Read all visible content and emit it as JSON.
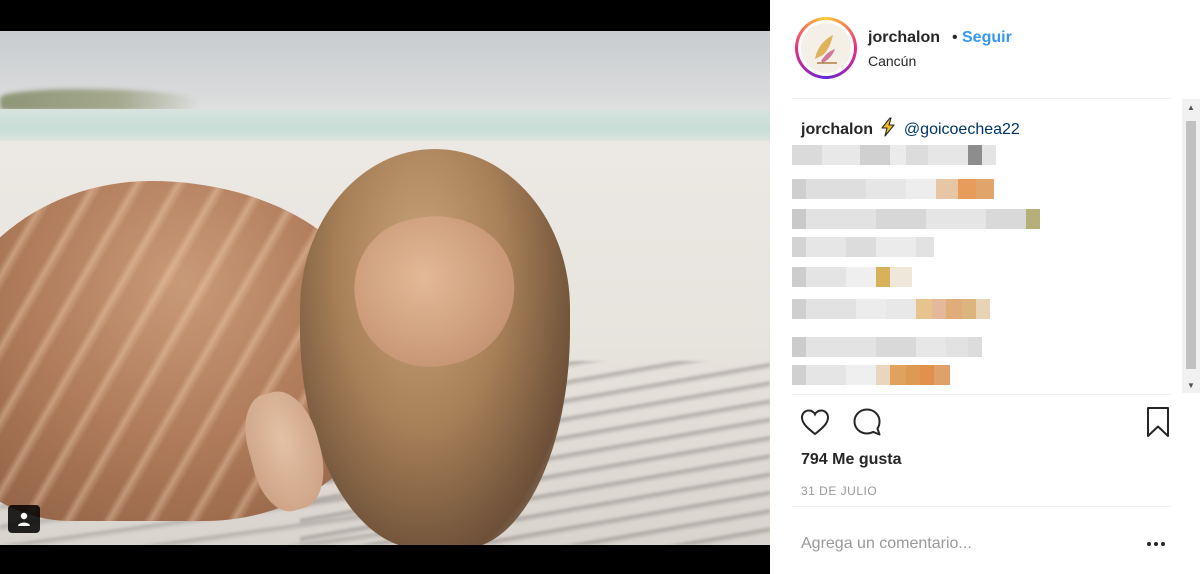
{
  "post": {
    "username": "jorchalon",
    "separator": "•",
    "follow_label": "Seguir",
    "location": "Cancún",
    "caption_username": "jorchalon",
    "caption_mention": "@goicoechea22",
    "likes_text": "794 Me gusta",
    "date_text": "31 DE JULIO",
    "comment_placeholder": "Agrega un comentario..."
  },
  "icons": {
    "tag": "user-tag-icon",
    "like": "heart-icon",
    "comment": "comment-icon",
    "save": "bookmark-icon",
    "more": "more-options-icon",
    "caption_emoji": "lightning-bolt-icon"
  },
  "colors": {
    "follow": "#3897f0",
    "mention": "#003569",
    "text": "#262626",
    "muted": "#999999"
  }
}
